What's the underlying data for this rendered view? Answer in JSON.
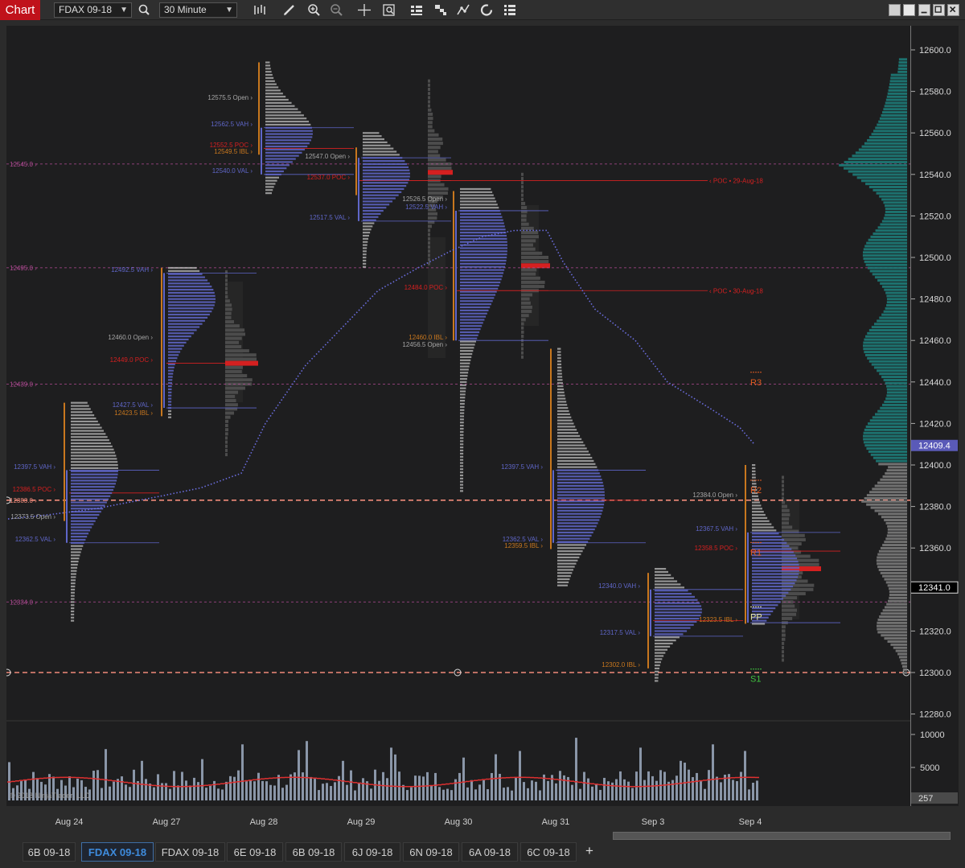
{
  "toolbar": {
    "chart_label": "Chart",
    "instrument": "FDAX 09-18",
    "interval": "30 Minute",
    "icons": [
      "search-icon",
      "bar-type-icon",
      "pencil-icon",
      "zoom-in-icon",
      "zoom-out-icon",
      "crosshair-icon",
      "properties-icon",
      "strategies-icon",
      "indicators-icon",
      "drawing-objects-icon",
      "refresh-icon",
      "data-box-icon"
    ]
  },
  "price_axis": {
    "ticks": [
      "12600.0",
      "12580.0",
      "12560.0",
      "12540.0",
      "12520.0",
      "12500.0",
      "12480.0",
      "12460.0",
      "12440.0",
      "12420.0",
      "12400.0",
      "12380.0",
      "12360.0",
      "12340.0",
      "12320.0",
      "12300.0",
      "12280.0"
    ],
    "last_price": "12341.0",
    "vwap_price": "12409.4"
  },
  "volume_axis": {
    "ticks": [
      "10000",
      "5000"
    ],
    "last_volume": "257"
  },
  "time_axis": {
    "labels": [
      "Aug 24",
      "Aug 27",
      "Aug 28",
      "Aug 29",
      "Aug 30",
      "Aug 31",
      "Sep 3",
      "Sep 4"
    ]
  },
  "levels": {
    "left_labels": [
      "12545.0",
      "12495.0",
      "12439.0",
      "12383.0",
      "12334.0"
    ],
    "pivots": [
      "R3",
      "R2",
      "R1",
      "PP",
      "S1"
    ],
    "poc_lines": [
      "POC • 29-Aug-18",
      "POC • 30-Aug-18"
    ]
  },
  "profile_labels": [
    {
      "text": "12397.5 VAH",
      "kind": "va"
    },
    {
      "text": "12386.5 POC",
      "kind": "poc"
    },
    {
      "text": "12373.5 Open",
      "kind": "open"
    },
    {
      "text": "12362.5 VAL",
      "kind": "va"
    },
    {
      "text": "12492.5 VAH",
      "kind": "va"
    },
    {
      "text": "12460.0 Open",
      "kind": "open"
    },
    {
      "text": "12449.0 POC",
      "kind": "poc"
    },
    {
      "text": "12427.5 VAL",
      "kind": "va"
    },
    {
      "text": "12423.5 IBL",
      "kind": "ib"
    },
    {
      "text": "12575.5 Open",
      "kind": "open"
    },
    {
      "text": "12562.5 VAH",
      "kind": "va"
    },
    {
      "text": "12552.5 POC",
      "kind": "poc"
    },
    {
      "text": "12549.5 IBL",
      "kind": "ib"
    },
    {
      "text": "12540.0 VAL",
      "kind": "va"
    },
    {
      "text": "12547.0 Open",
      "kind": "open"
    },
    {
      "text": "12537.0 POC",
      "kind": "poc"
    },
    {
      "text": "12517.5 VAL",
      "kind": "va"
    },
    {
      "text": "12526.5 Open",
      "kind": "open"
    },
    {
      "text": "12522.5 VAH",
      "kind": "va"
    },
    {
      "text": "12484.0 POC",
      "kind": "poc"
    },
    {
      "text": "12460.0 IBL",
      "kind": "ib"
    },
    {
      "text": "12456.5 Open",
      "kind": "open"
    },
    {
      "text": "12397.5 VAH",
      "kind": "va"
    },
    {
      "text": "12362.5 VAL",
      "kind": "va"
    },
    {
      "text": "12359.5 IBL",
      "kind": "ib"
    },
    {
      "text": "12340.0 VAH",
      "kind": "va"
    },
    {
      "text": "12317.5 VAL",
      "kind": "va"
    },
    {
      "text": "12302.0 IBL",
      "kind": "ib"
    },
    {
      "text": "12384.0 Open",
      "kind": "open"
    },
    {
      "text": "12367.5 VAH",
      "kind": "va"
    },
    {
      "text": "12358.5 POC",
      "kind": "poc"
    },
    {
      "text": "12323.5 IBL",
      "kind": "ib"
    }
  ],
  "copyright": "© 2018 NinjaTrader, LLC",
  "colors": {
    "accent_red": "#c0121b",
    "poc": "#d42020",
    "va": "#5f66c8",
    "ib_bar": "#c8771e",
    "vwap": "#6b6ee0",
    "level_line": "#b14a94",
    "pivot_red": "#e05a20",
    "pivot_green": "#3fc23f",
    "volume_profile": "#1d7b78"
  },
  "tabs": [
    "6B 09-18",
    "FDAX 09-18",
    "FDAX 09-18",
    "6E 09-18",
    "6B 09-18",
    "6J 09-18",
    "6N 09-18",
    "6A 09-18",
    "6C 09-18"
  ],
  "active_tab": 1
}
